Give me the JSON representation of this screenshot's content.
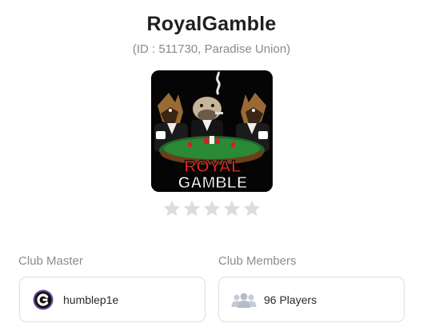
{
  "club": {
    "name": "RoyalGamble",
    "id_line": "(ID : 511730, Paradise Union)",
    "logo_text_top": "ROYAL",
    "logo_text_bottom": "GAMBLE",
    "rating": {
      "value": 0,
      "max": 5
    }
  },
  "master": {
    "label": "Club Master",
    "username": "humblep1e",
    "avatar_icon": "c-logo-avatar-icon"
  },
  "members": {
    "label": "Club Members",
    "count_text": "96 Players",
    "icon": "people-group-icon"
  },
  "colors": {
    "title": "#1f1f1f",
    "muted": "#8a8a8a",
    "star_empty": "#dcdcdc",
    "card_border": "#dddddd",
    "logo_red": "#e0262b",
    "avatar_purple": "#6b4aa8"
  }
}
